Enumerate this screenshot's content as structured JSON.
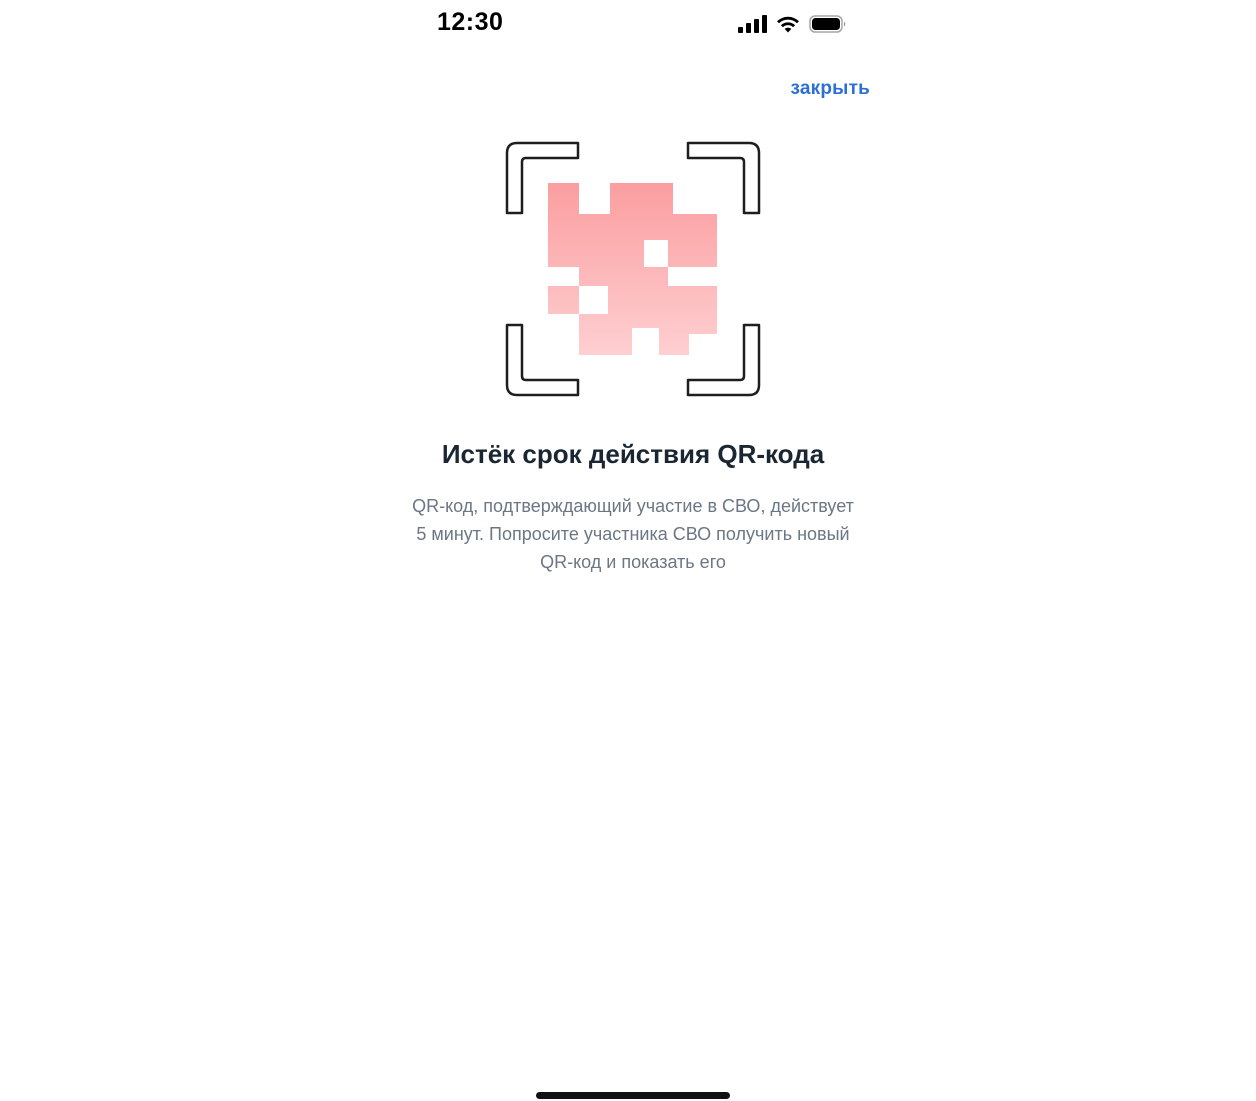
{
  "status_bar": {
    "time": "12:30",
    "icons": [
      "cellular-signal-icon",
      "wifi-icon",
      "battery-icon"
    ]
  },
  "header": {
    "close_label": "закрыть"
  },
  "illustration": {
    "icon": "expired-qr-code-icon",
    "accent_color": "#fb9ea0"
  },
  "content": {
    "title": "Истёк срок действия QR-кода",
    "description": "QR-код, подтверждающий участие в СВО, действует 5 минут. Попросите участника СВО получить новый QR-код и показать его"
  },
  "colors": {
    "link": "#2d6fd6",
    "title": "#1b2633",
    "description": "#6b7784"
  }
}
